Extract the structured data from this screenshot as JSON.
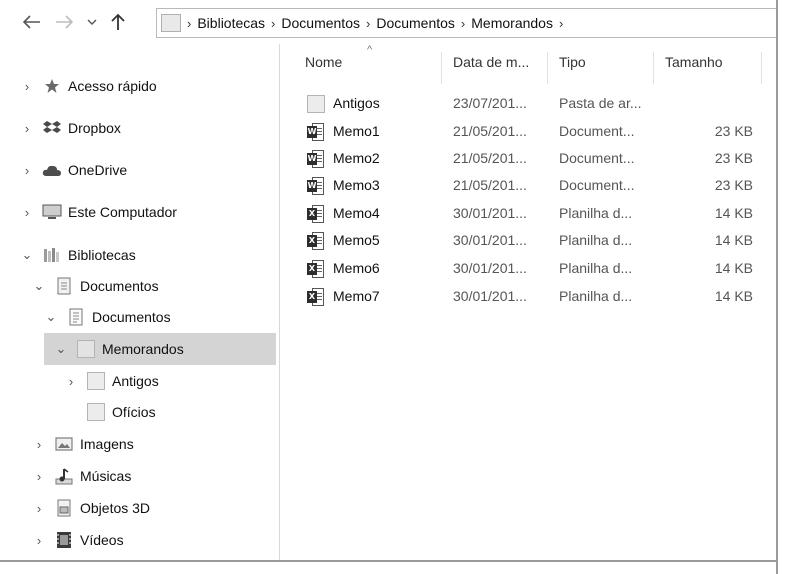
{
  "breadcrumb": [
    "Bibliotecas",
    "Documentos",
    "Documentos",
    "Memorandos"
  ],
  "icons": {
    "back": "arrow-left-icon",
    "forward": "arrow-right-icon",
    "recent": "chevron-down-icon",
    "up": "arrow-up-icon"
  },
  "sidebar": {
    "items": [
      {
        "label": "Acesso rápido",
        "icon": "star-icon"
      },
      {
        "label": "Dropbox",
        "icon": "dropbox-icon"
      },
      {
        "label": "OneDrive",
        "icon": "cloud-icon"
      },
      {
        "label": "Este Computador",
        "icon": "computer-icon"
      },
      {
        "label": "Bibliotecas",
        "icon": "library-icon"
      },
      {
        "label": "Documentos",
        "icon": "documents-icon"
      },
      {
        "label": "Documentos",
        "icon": "document-folder-icon"
      },
      {
        "label": "Memorandos",
        "icon": "folder-icon"
      },
      {
        "label": "Antigos",
        "icon": "folder-icon"
      },
      {
        "label": "Ofícios",
        "icon": "folder-icon"
      },
      {
        "label": "Imagens",
        "icon": "pictures-icon"
      },
      {
        "label": "Músicas",
        "icon": "music-icon"
      },
      {
        "label": "Objetos 3D",
        "icon": "objects-3d-icon"
      },
      {
        "label": "Vídeos",
        "icon": "video-icon"
      }
    ]
  },
  "columns": {
    "name": "Nome",
    "date": "Data de m...",
    "type": "Tipo",
    "size": "Tamanho"
  },
  "files": [
    {
      "name": "Antigos",
      "date": "23/07/201...",
      "type": "Pasta de ar...",
      "size": "",
      "icon": "folder-icon"
    },
    {
      "name": "Memo1",
      "date": "21/05/201...",
      "type": "Document...",
      "size": "23 KB",
      "icon": "word-document-icon"
    },
    {
      "name": "Memo2",
      "date": "21/05/201...",
      "type": "Document...",
      "size": "23 KB",
      "icon": "word-document-icon"
    },
    {
      "name": "Memo3",
      "date": "21/05/201...",
      "type": "Document...",
      "size": "23 KB",
      "icon": "word-document-icon"
    },
    {
      "name": "Memo4",
      "date": "30/01/201...",
      "type": "Planilha d...",
      "size": "14 KB",
      "icon": "excel-spreadsheet-icon"
    },
    {
      "name": "Memo5",
      "date": "30/01/201...",
      "type": "Planilha d...",
      "size": "14 KB",
      "icon": "excel-spreadsheet-icon"
    },
    {
      "name": "Memo6",
      "date": "30/01/201...",
      "type": "Planilha d...",
      "size": "14 KB",
      "icon": "excel-spreadsheet-icon"
    },
    {
      "name": "Memo7",
      "date": "30/01/201...",
      "type": "Planilha d...",
      "size": "14 KB",
      "icon": "excel-spreadsheet-icon"
    }
  ]
}
